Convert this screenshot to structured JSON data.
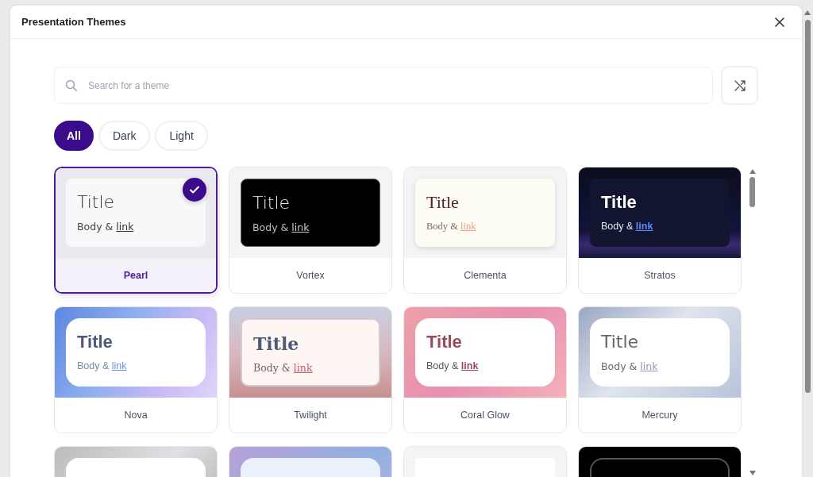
{
  "dialog": {
    "title": "Presentation Themes"
  },
  "search": {
    "placeholder": "Search for a theme"
  },
  "filters": [
    {
      "label": "All",
      "selected": true
    },
    {
      "label": "Dark",
      "selected": false
    },
    {
      "label": "Light",
      "selected": false
    }
  ],
  "themes": [
    {
      "name": "Pearl",
      "selected": true,
      "preview": {
        "title": "Title",
        "body": "Body &",
        "link": "link"
      }
    },
    {
      "name": "Vortex",
      "selected": false,
      "preview": {
        "title": "Title",
        "body": "Body &",
        "link": "link"
      }
    },
    {
      "name": "Clementa",
      "selected": false,
      "preview": {
        "title": "Title",
        "body": "Body &",
        "link": "link"
      }
    },
    {
      "name": "Stratos",
      "selected": false,
      "preview": {
        "title": "Title",
        "body": "Body &",
        "link": "link"
      }
    },
    {
      "name": "Nova",
      "selected": false,
      "preview": {
        "title": "Title",
        "body": "Body &",
        "link": "link"
      }
    },
    {
      "name": "Twilight",
      "selected": false,
      "preview": {
        "title": "Title",
        "body": "Body &",
        "link": "link"
      }
    },
    {
      "name": "Coral Glow",
      "selected": false,
      "preview": {
        "title": "Title",
        "body": "Body &",
        "link": "link"
      }
    },
    {
      "name": "Mercury",
      "selected": false,
      "preview": {
        "title": "Title",
        "body": "Body &",
        "link": "link"
      }
    },
    {
      "selected": false
    },
    {
      "selected": false
    },
    {
      "selected": false
    },
    {
      "selected": false
    }
  ]
}
